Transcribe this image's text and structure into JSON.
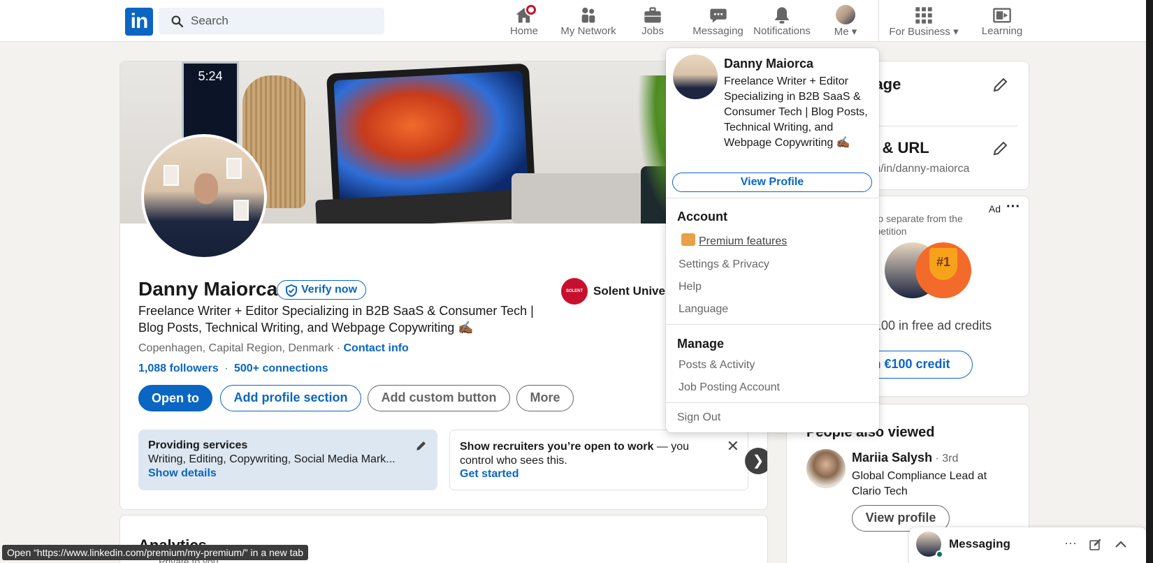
{
  "nav": {
    "logo": "in",
    "search_placeholder": "Search",
    "items": [
      {
        "label": "Home"
      },
      {
        "label": "My Network"
      },
      {
        "label": "Jobs"
      },
      {
        "label": "Messaging"
      },
      {
        "label": "Notifications"
      },
      {
        "label": "Me"
      },
      {
        "label": "For Business"
      },
      {
        "label": "Learning"
      }
    ]
  },
  "profile": {
    "phone_time": "5:24",
    "name": "Danny Maiorca",
    "verify_label": "Verify now",
    "headline": "Freelance Writer + Editor Specializing in B2B SaaS & Consumer Tech | Blog Posts, Technical Writing, and Webpage Copywriting ✍🏾",
    "location": "Copenhagen, Capital Region, Denmark",
    "location_sep": " · ",
    "contact_info": "Contact info",
    "followers": "1,088 followers",
    "connections": "500+ connections",
    "school": "Solent Univer",
    "school_logo": "SOLENT",
    "buttons": {
      "open_to": "Open to",
      "add_section": "Add profile section",
      "add_custom": "Add custom button",
      "more": "More"
    },
    "services": {
      "title": "Providing services",
      "desc": "Writing, Editing, Copywriting, Social Media Mark...",
      "link": "Show details"
    },
    "recruiters": {
      "bold": "Show recruiters you’re open to work",
      "rest": " — you control who sees this.",
      "link": "Get started"
    }
  },
  "analytics": {
    "title": "Analytics",
    "subtitle": "Private to you"
  },
  "right": {
    "language_title": "uage",
    "url_title": "le & URL",
    "url_value": "om/in/danny-maiorca",
    "ad_label": "Ad",
    "ad_text": "ads to separate from the competition",
    "trophy_text": "#1",
    "ad_credits": "n €100 in free ad credits",
    "ad_button": "m €100 credit",
    "people_title": "People also viewed",
    "person_name": "Mariia Salysh",
    "person_degree": " · 3rd",
    "person_role": "Global Compliance Lead at Clario Tech",
    "view_profile": "View profile"
  },
  "menu": {
    "name": "Danny Maiorca",
    "headline": "Freelance Writer + Editor Specializing in B2B SaaS & Consumer Tech | Blog Posts, Technical Writing, and Webpage Copywriting ✍🏾",
    "view_profile": "View Profile",
    "account_title": "Account",
    "premium": "Premium features",
    "settings": "Settings & Privacy",
    "help": "Help",
    "language": "Language",
    "manage_title": "Manage",
    "posts": "Posts & Activity",
    "job_posting": "Job Posting Account",
    "sign_out": "Sign Out"
  },
  "messaging": {
    "label": "Messaging"
  },
  "status_url": "Open “https://www.linkedin.com/premium/my-premium/” in a new tab",
  "colors": {
    "accent": "#0a66c2",
    "notification": "#cb112d",
    "background": "#f4f2ee"
  }
}
